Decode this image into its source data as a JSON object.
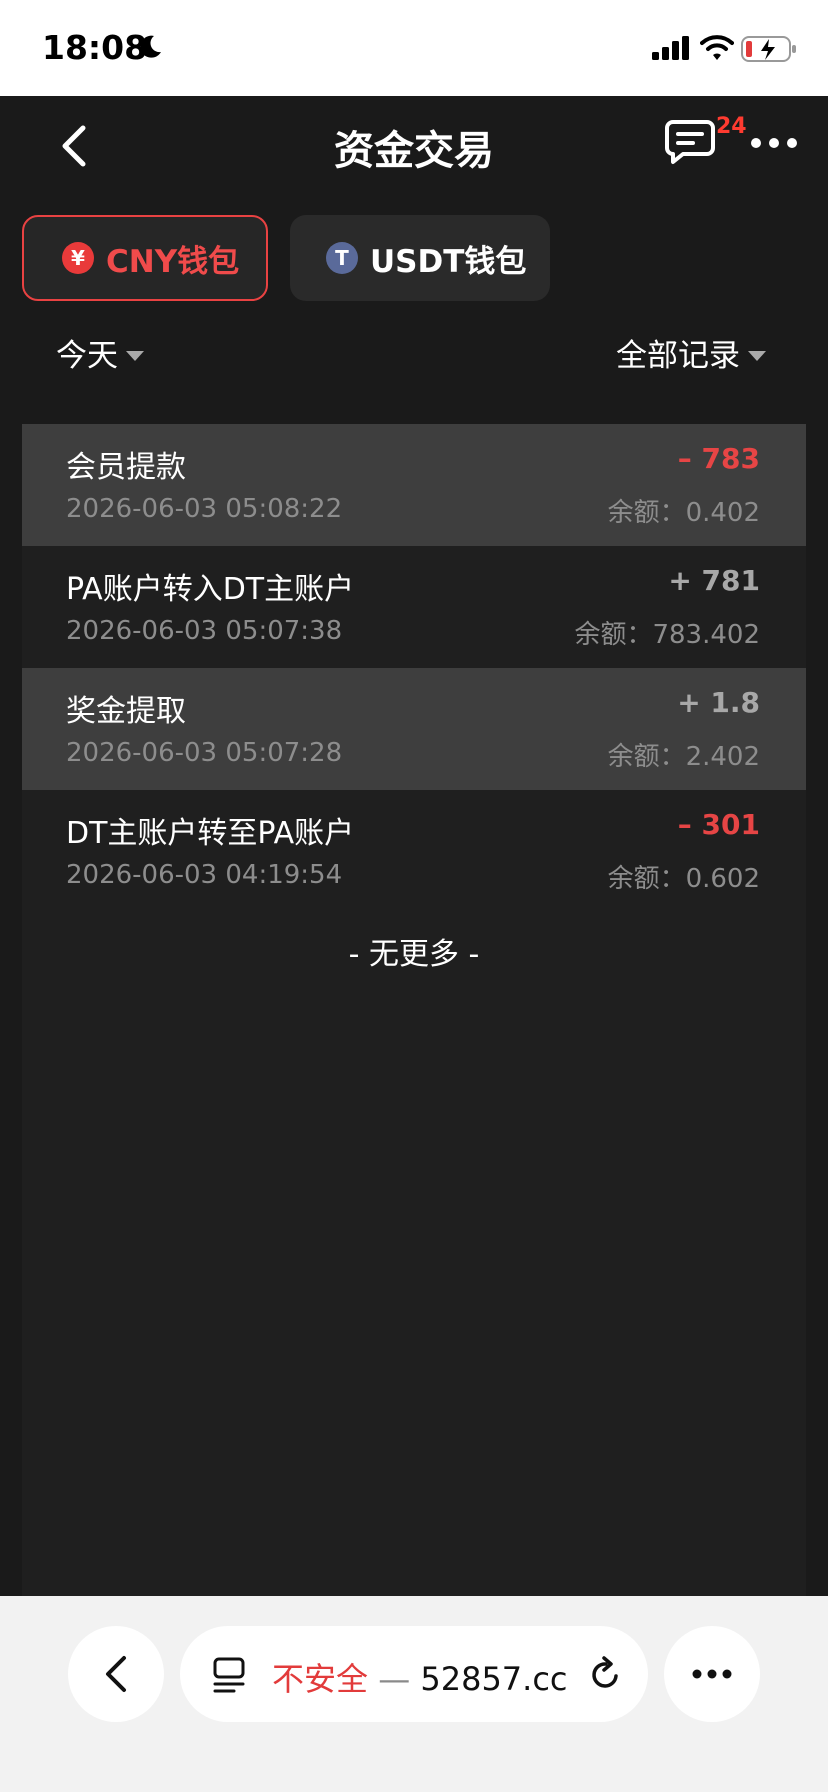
{
  "status_bar": {
    "time": "18:08"
  },
  "header": {
    "title": "资金交易",
    "message_count": "24"
  },
  "tabs": [
    {
      "coin": "¥",
      "label": "CNY钱包",
      "active": true
    },
    {
      "coin": "T",
      "label": "USDT钱包",
      "active": false
    }
  ],
  "filters": {
    "date": "今天",
    "type": "全部记录"
  },
  "transactions": [
    {
      "title": "会员提款",
      "time": "2026-06-03 05:08:22",
      "amount": "– 783",
      "balance": "余额：0.402"
    },
    {
      "title": "PA账户转入DT主账户",
      "time": "2026-06-03 05:07:38",
      "amount": "+ 781",
      "balance": "余额：783.402"
    },
    {
      "title": "奖金提取",
      "time": "2026-06-03 05:07:28",
      "amount": "+ 1.8",
      "balance": "余额：2.402"
    },
    {
      "title": "DT主账户转至PA账户",
      "time": "2026-06-03 04:19:54",
      "amount": "– 301",
      "balance": "余额：0.602"
    }
  ],
  "no_more": "- 无更多 -",
  "browser": {
    "insecure": "不安全",
    "dash": " — ",
    "domain": "52857.cc"
  },
  "colors": {
    "accent": "#e94242",
    "background": "#1a1a1a",
    "highlight_row": "#3e3e3e"
  }
}
